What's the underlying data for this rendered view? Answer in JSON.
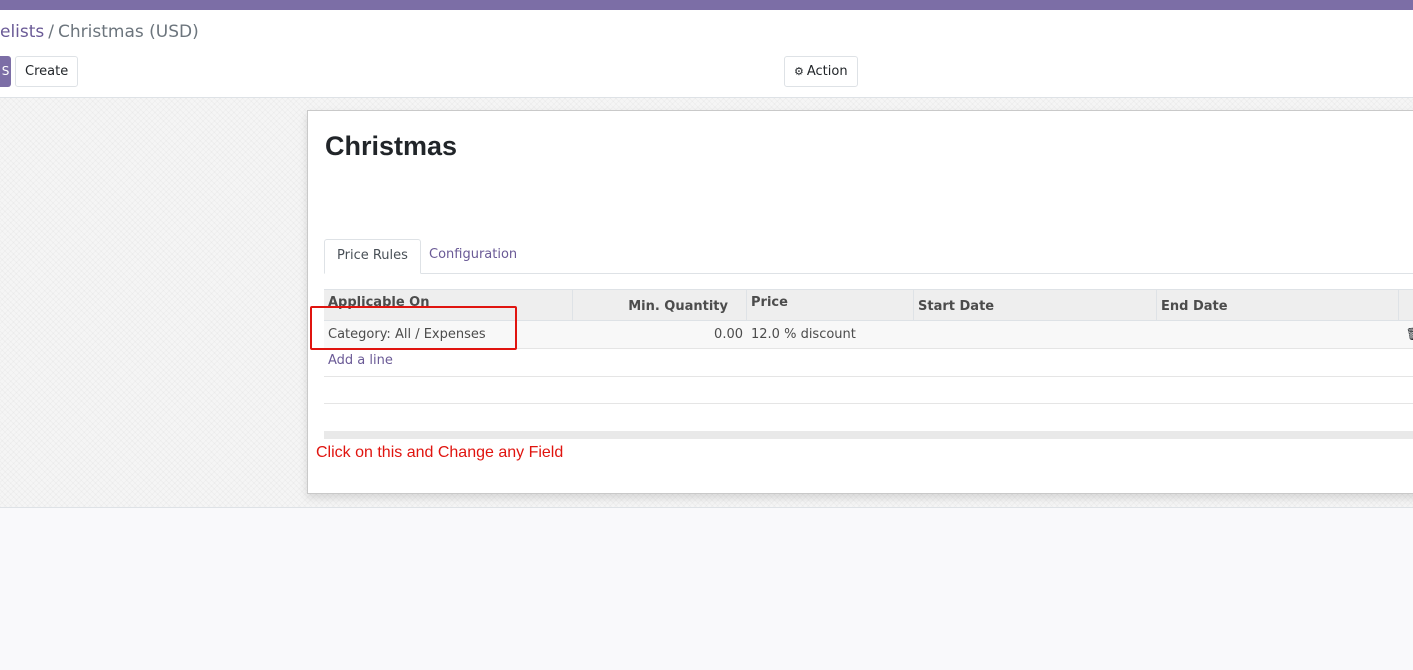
{
  "breadcrumb": {
    "parent": "elists",
    "separator": "/",
    "current": "Christmas (USD)"
  },
  "toolbar": {
    "save_label": "S",
    "create_label": "Create",
    "action_label": "Action",
    "action_icon": "gear-icon"
  },
  "record": {
    "title": "Christmas"
  },
  "tabs": [
    {
      "label": "Price Rules",
      "active": true
    },
    {
      "label": "Configuration",
      "active": false
    }
  ],
  "table": {
    "columns": [
      "Applicable On",
      "Min. Quantity",
      "Price",
      "Start Date",
      "End Date"
    ],
    "rows": [
      {
        "applicable_on": "Category: All / Expenses",
        "min_quantity": "0.00",
        "price": "12.0 % discount",
        "start_date": "",
        "end_date": ""
      }
    ],
    "add_line_label": "Add a line",
    "row_delete_icon": "trash-icon"
  },
  "annotation": {
    "text": "Click on this and Change any Field",
    "color": "#e0140f"
  },
  "colors": {
    "brand": "#7c6ea6",
    "link": "#6a5a96"
  }
}
